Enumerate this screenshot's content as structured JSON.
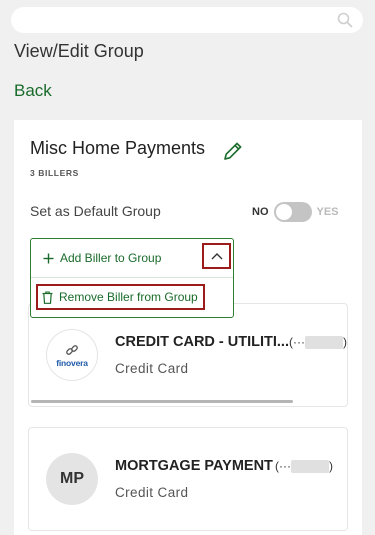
{
  "search": {
    "placeholder": ""
  },
  "page": {
    "title": "View/Edit Group",
    "back_label": "Back"
  },
  "group": {
    "name": "Misc Home Payments",
    "billers_count": "3 BILLERS",
    "default_label": "Set as Default Group",
    "toggle_no": "NO",
    "toggle_yes": "YES",
    "is_default": false
  },
  "menu": {
    "add_label": "Add Biller to Group",
    "remove_label": "Remove Biller from Group",
    "expanded": true
  },
  "billers": [
    {
      "name": "CREDIT CARD - UTILITI...",
      "account": "(···",
      "account_close": ")",
      "type": "Credit Card",
      "logo_text": "finovera"
    },
    {
      "name": "MORTGAGE PAYMENT",
      "account": "(···",
      "account_close": ")",
      "type": "Credit Card",
      "initials": "MP"
    }
  ],
  "colors": {
    "accent": "#1a6b2b",
    "highlight": "#9c1c1c",
    "logo": "#1e5aa8"
  },
  "icons": [
    "search-icon",
    "pencil-icon",
    "plus-icon",
    "chevron-up-icon",
    "trash-icon",
    "link-icon"
  ]
}
